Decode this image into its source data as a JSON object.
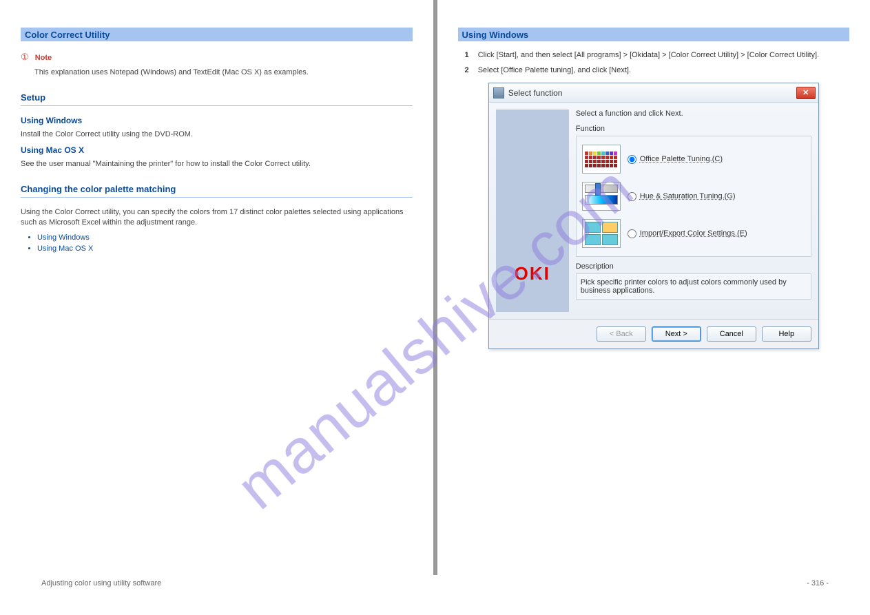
{
  "watermark": "manualshive.com",
  "left": {
    "utility_title": "Color Correct Utility",
    "note_label": "Note",
    "note_text": "This explanation uses Notepad (Windows) and TextEdit (Mac OS X) as examples.",
    "setup_h": "Setup",
    "setup_windows_h": "Using Windows",
    "setup_windows_body": "Install the Color Correct utility using the DVD-ROM.",
    "setup_mac_h": "Using Mac OS X",
    "setup_mac_body": "See the user manual \"Maintaining the printer\" for how to install the Color Correct utility.",
    "ccpm_h": "Changing the color palette matching",
    "ccpm_body": "Using the Color Correct utility, you can specify the colors from 17 distinct color palettes selected using applications such as Microsoft Excel within the adjustment range.",
    "funcs": {
      "windows": "Using Windows",
      "macos": "Using Mac OS X"
    }
  },
  "right": {
    "sect_windows": "Using Windows",
    "step1": {
      "num": "1",
      "text": "Click [Start], and then select [All programs] > [Okidata] > [Color Correct Utility] > [Color Correct Utility]."
    },
    "step2": {
      "num": "2",
      "text": "Select [Office Palette tuning], and click [Next]."
    },
    "dialog": {
      "title": "Select function",
      "intro": "Select a function and click Next.",
      "grp_label": "Function",
      "opts": {
        "office": "Office Palette Tuning.(C)",
        "hue": "Hue & Saturation Tuning.(G)",
        "impexp": "Import/Export Color Settings.(E)"
      },
      "desc_label": "Description",
      "desc_text": "Pick specific printer colors to adjust colors commonly used by business applications.",
      "btns": {
        "back": "< Back",
        "next": "Next >",
        "cancel": "Cancel",
        "help": "Help"
      }
    }
  },
  "footer": {
    "left": "Adjusting color using utility software",
    "page": "- 316 -"
  }
}
